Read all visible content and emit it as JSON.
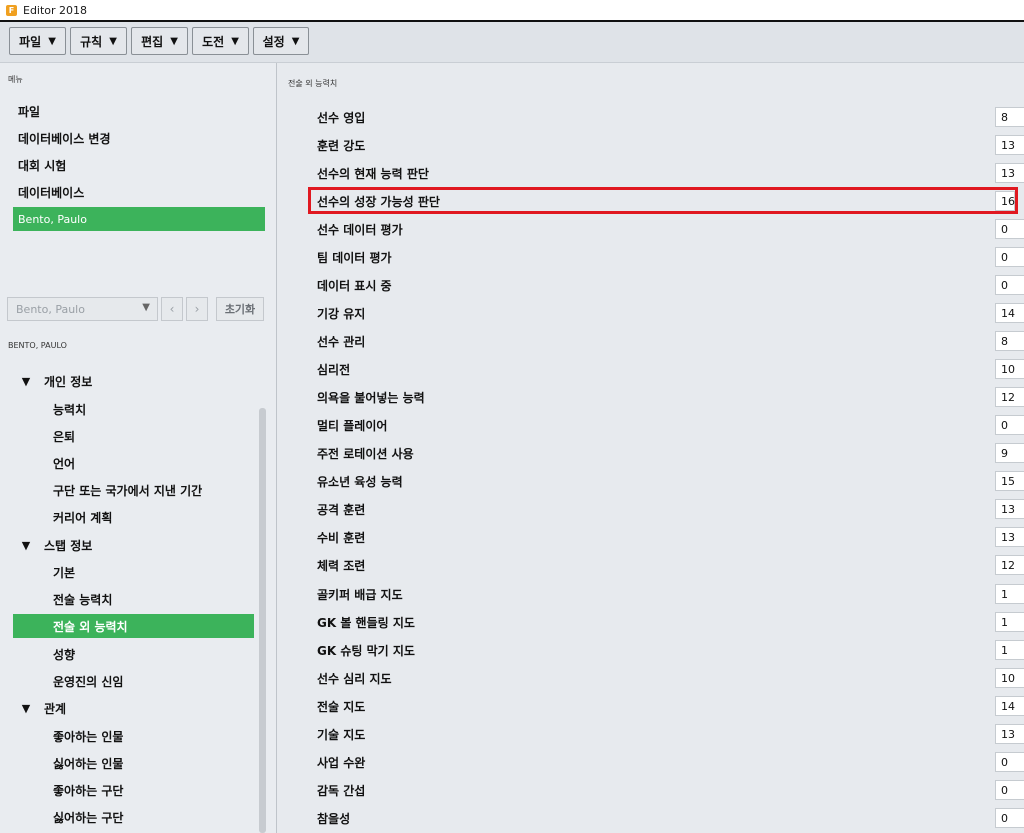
{
  "window": {
    "title": "Editor 2018"
  },
  "toolbar": {
    "menus": [
      {
        "label": "파일"
      },
      {
        "label": "규칙"
      },
      {
        "label": "편집"
      },
      {
        "label": "도전"
      },
      {
        "label": "설정"
      }
    ]
  },
  "sidebar": {
    "menu_header": "메뉴",
    "nav_items": [
      {
        "label": "파일"
      },
      {
        "label": "데이터베이스 변경"
      },
      {
        "label": "대회 시험"
      },
      {
        "label": "데이터베이스"
      }
    ],
    "selected_nav": "Bento, Paulo",
    "person_select": {
      "value": "Bento, Paulo"
    },
    "reset_label": "초기화",
    "person_header": "BENTO, PAULO",
    "tree": {
      "personal": {
        "label": "개인 정보",
        "items": [
          "능력치",
          "은퇴",
          "언어",
          "구단 또는 국가에서 지낸 기간",
          "커리어 계획"
        ]
      },
      "staff": {
        "label": "스탭 정보",
        "items": [
          "기본",
          "전술 능력치",
          "전술 외 능력치",
          "성향",
          "운영진의 신임"
        ]
      },
      "relations": {
        "label": "관계",
        "items": [
          "좋아하는 인물",
          "싫어하는 인물",
          "좋아하는 구단",
          "싫어하는 구단"
        ]
      }
    }
  },
  "main": {
    "header": "전술 외 능력치",
    "attributes": [
      {
        "label": "선수 영입",
        "value": "8"
      },
      {
        "label": "훈련 강도",
        "value": "13"
      },
      {
        "label": "선수의 현재 능력 판단",
        "value": "13"
      },
      {
        "label": "선수의 성장 가능성 판단",
        "value": "16"
      },
      {
        "label": "선수 데이터 평가",
        "value": "0"
      },
      {
        "label": "팀 데이터 평가",
        "value": "0"
      },
      {
        "label": "데이터 표시 중",
        "value": "0"
      },
      {
        "label": "기강 유지",
        "value": "14"
      },
      {
        "label": "선수 관리",
        "value": "8"
      },
      {
        "label": "심리전",
        "value": "10"
      },
      {
        "label": "의욕을 불어넣는 능력",
        "value": "12"
      },
      {
        "label": "멀티 플레이어",
        "value": "0"
      },
      {
        "label": "주전 로테이션 사용",
        "value": "9"
      },
      {
        "label": "유소년 육성 능력",
        "value": "15"
      },
      {
        "label": "공격 훈련",
        "value": "13"
      },
      {
        "label": "수비 훈련",
        "value": "13"
      },
      {
        "label": "체력 조련",
        "value": "12"
      },
      {
        "label": "골키퍼 배급 지도",
        "value": "1"
      },
      {
        "label": "GK 볼 핸들링 지도",
        "value": "1"
      },
      {
        "label": "GK 슈팅 막기 지도",
        "value": "1"
      },
      {
        "label": "선수 심리 지도",
        "value": "10"
      },
      {
        "label": "전술 지도",
        "value": "14"
      },
      {
        "label": "기술 지도",
        "value": "13"
      },
      {
        "label": "사업 수완",
        "value": "0"
      },
      {
        "label": "감독 간섭",
        "value": "0"
      },
      {
        "label": "참을성",
        "value": "0"
      }
    ]
  },
  "colors": {
    "accent": "#3cb35b",
    "highlight": "#e01820"
  },
  "icons": {
    "chevron": "chevron-down-icon",
    "app": "app-icon"
  }
}
